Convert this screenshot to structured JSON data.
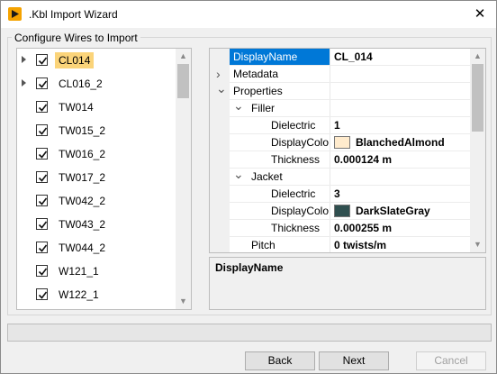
{
  "window": {
    "title": ".Kbl Import Wizard",
    "close_glyph": "✕"
  },
  "group": {
    "label": "Configure Wires to Import"
  },
  "tree": {
    "items": [
      {
        "label": "CL014",
        "checked": true,
        "expandable": true,
        "selected": true
      },
      {
        "label": "CL016_2",
        "checked": true,
        "expandable": true,
        "selected": false
      },
      {
        "label": "TW014",
        "checked": true,
        "expandable": false,
        "selected": false
      },
      {
        "label": "TW015_2",
        "checked": true,
        "expandable": false,
        "selected": false
      },
      {
        "label": "TW016_2",
        "checked": true,
        "expandable": false,
        "selected": false
      },
      {
        "label": "TW017_2",
        "checked": true,
        "expandable": false,
        "selected": false
      },
      {
        "label": "TW042_2",
        "checked": true,
        "expandable": false,
        "selected": false
      },
      {
        "label": "TW043_2",
        "checked": true,
        "expandable": false,
        "selected": false
      },
      {
        "label": "TW044_2",
        "checked": true,
        "expandable": false,
        "selected": false
      },
      {
        "label": "W121_1",
        "checked": true,
        "expandable": false,
        "selected": false
      },
      {
        "label": "W122_1",
        "checked": true,
        "expandable": false,
        "selected": false
      }
    ]
  },
  "properties": {
    "rows": [
      {
        "name": "DisplayName",
        "value": "CL_014",
        "level": 0,
        "chevron": "",
        "selected": true
      },
      {
        "name": "Metadata",
        "value": "",
        "level": 0,
        "chevron": "collapsed"
      },
      {
        "name": "Properties",
        "value": "",
        "level": 0,
        "chevron": "expanded"
      },
      {
        "name": "Filler",
        "value": "",
        "level": 1,
        "chevron": "expanded"
      },
      {
        "name": "Dielectric",
        "value": "1",
        "level": 2,
        "chevron": ""
      },
      {
        "name": "DisplayColo",
        "value": "BlanchedAlmond",
        "level": 2,
        "chevron": "",
        "swatch": "#ffebcd"
      },
      {
        "name": "Thickness",
        "value": "0.000124 m",
        "level": 2,
        "chevron": ""
      },
      {
        "name": "Jacket",
        "value": "",
        "level": 1,
        "chevron": "expanded"
      },
      {
        "name": "Dielectric",
        "value": "3",
        "level": 2,
        "chevron": ""
      },
      {
        "name": "DisplayColo",
        "value": "DarkSlateGray",
        "level": 2,
        "chevron": "",
        "swatch": "#2f4f4f"
      },
      {
        "name": "Thickness",
        "value": "0.000255 m",
        "level": 2,
        "chevron": ""
      },
      {
        "name": "Pitch",
        "value": "0 twists/m",
        "level": 1,
        "chevron": ""
      }
    ]
  },
  "description": {
    "title": "DisplayName"
  },
  "progress": {
    "value": 0
  },
  "buttons": {
    "back": "Back",
    "next": "Next",
    "cancel": "Cancel"
  },
  "colors": {
    "selection_blue": "#0078d7",
    "tree_selection": "#fbd47a"
  }
}
